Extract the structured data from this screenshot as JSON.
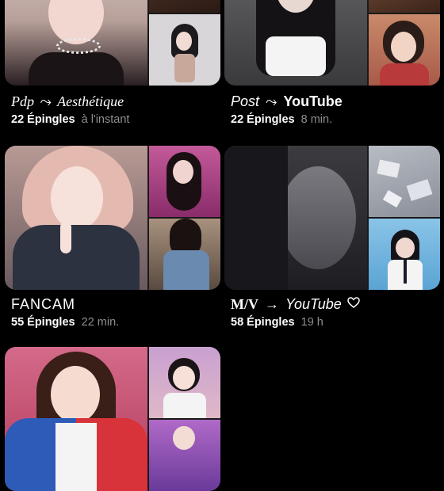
{
  "boards": [
    {
      "title_parts": [
        "Pdp",
        "⤳",
        "Aesthétique"
      ],
      "title_style": "serif-italic",
      "pins": "22 Épingles",
      "time": "à l'instant"
    },
    {
      "title_parts": [
        "Post",
        "⤳",
        "YouTube"
      ],
      "title_style": "mixed-italic-bold",
      "pins": "22 Épingles",
      "time": "8 min."
    },
    {
      "title_parts": [
        "FANCAM",
        "",
        ""
      ],
      "title_style": "thin-caps",
      "pins": "55 Épingles",
      "time": "22 min."
    },
    {
      "title_parts": [
        "M/V",
        "→",
        "YouTube"
      ],
      "title_style": "serif-bold-italic",
      "heart_icon": "heart-outline-icon",
      "pins": "58 Épingles",
      "time": "19 h"
    },
    {
      "title_parts": [
        "",
        "",
        ""
      ],
      "pins": "",
      "time": ""
    }
  ],
  "colors": {
    "background": "#000000",
    "text_primary": "#ffffff",
    "text_secondary": "#8e8e8e"
  }
}
